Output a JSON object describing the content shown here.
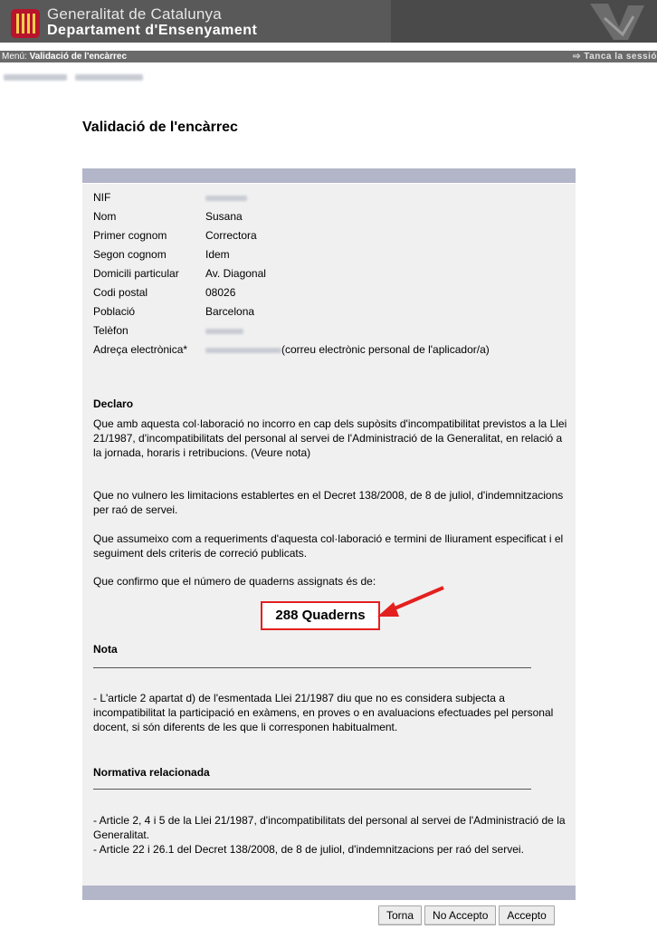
{
  "header": {
    "org_name": "Generalitat de Catalunya",
    "dept_name": "Departament d'Ensenyament"
  },
  "menu": {
    "prefix": "Menú:",
    "current": "Validació de l'encàrrec",
    "logout": "⇨ Tanca la sessió"
  },
  "page": {
    "title": "Validació de l'encàrrec"
  },
  "fields": [
    {
      "label": "NIF",
      "value": ""
    },
    {
      "label": "Nom",
      "value": "Susana"
    },
    {
      "label": "Primer cognom",
      "value": "Correctora"
    },
    {
      "label": "Segon cognom",
      "value": "Idem"
    },
    {
      "label": "Domicili particular",
      "value": "Av. Diagonal"
    },
    {
      "label": "Codi postal",
      "value": "08026"
    },
    {
      "label": "Població",
      "value": "Barcelona"
    },
    {
      "label": "Telèfon",
      "value": ""
    },
    {
      "label": "Adreça electrònica*",
      "value": "",
      "note": "(correu electrònic personal de l'aplicador/a)"
    }
  ],
  "declaro": {
    "title": "Declaro",
    "p1": "Que amb aquesta col·laboració no incorro en cap dels supòsits d'incompatibilitat previstos a la Llei 21/1987, d'incompatibilitats del personal al servei de l'Administració de la Generalitat, en relació a la jornada, horaris i retribucions. (Veure nota)",
    "p2": "Que no vulnero les limitacions establertes en el Decret 138/2008, de 8 de juliol, d'indemnitzacions per raó de servei.",
    "p3": "Que assumeixo com a requeriments d'aquesta col·laboració e termini de lliurament especificat i el seguiment dels criteris de correció publicats.",
    "p4": "Que confirmo que el número de quaderns assignats és de:",
    "quaderns": "288 Quaderns"
  },
  "nota": {
    "title": "Nota",
    "text": "- L'article 2 apartat d) de l'esmentada Llei 21/1987 diu que no es considera subjecta a incompatibilitat la participació en exàmens, en proves o en avaluacions efectuades pel personal docent, si són diferents de les que li corresponen habitualment."
  },
  "normativa": {
    "title": "Normativa relacionada",
    "item1": "- Article 2, 4 i 5 de la Llei 21/1987, d'incompatibilitats del personal al servei de l'Administració de la Generalitat.",
    "item2": "- Article 22 i 26.1 del Decret 138/2008, de 8 de juliol, d'indemnitzacions per raó del servei."
  },
  "buttons": {
    "back": "Torna",
    "reject": "No Accepto",
    "accept": "Accepto"
  },
  "colors": {
    "header_bg": "#595959",
    "panel_bg": "#f0f0f0",
    "bar": "#b3b5c8",
    "highlight": "#e4201f"
  }
}
